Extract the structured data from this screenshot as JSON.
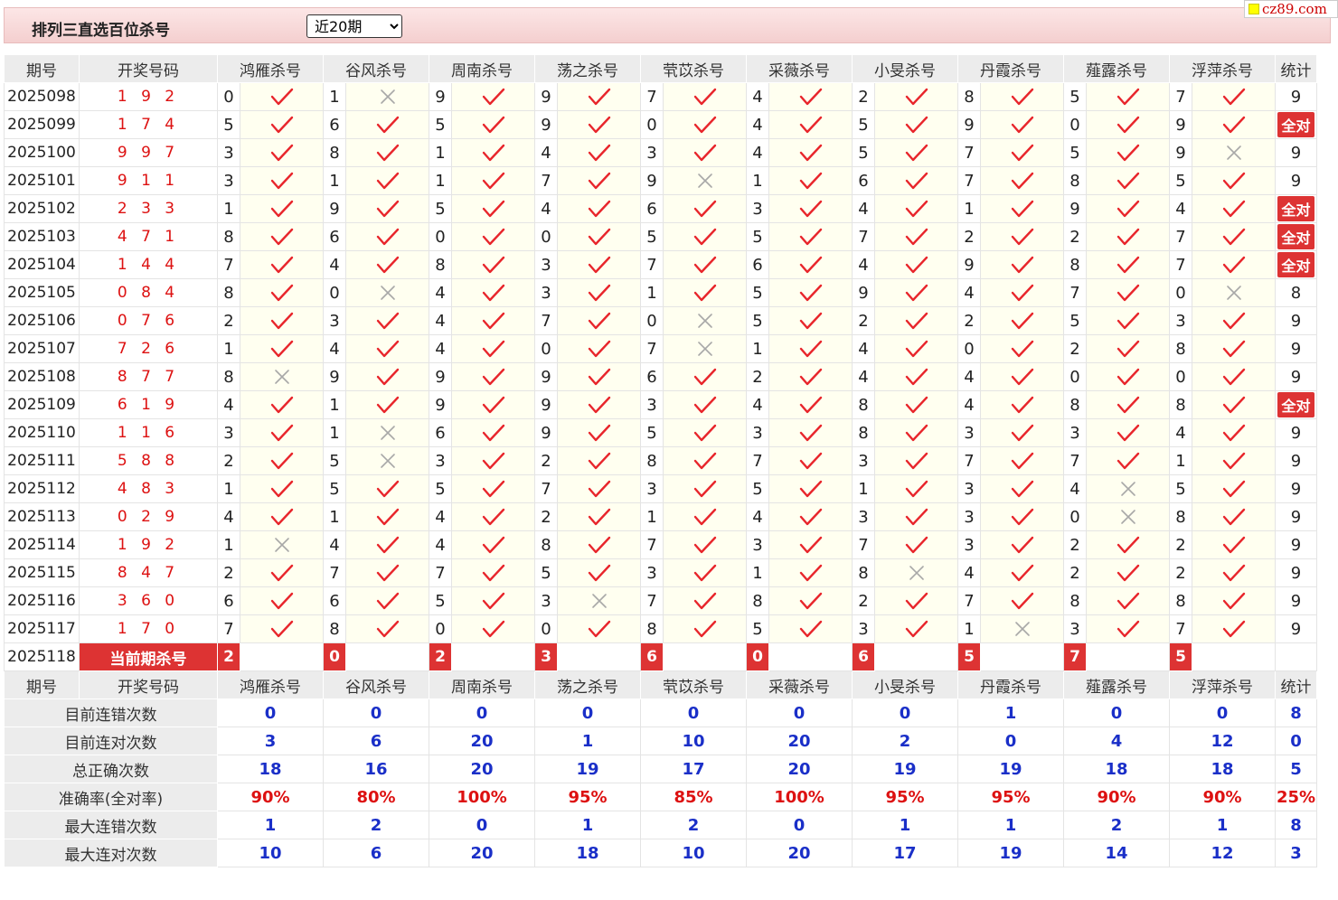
{
  "header": {
    "title": "排列三直选百位杀号",
    "period_selected": "近20期",
    "period_options": [
      "近20期"
    ],
    "site_logo": "cz89.com"
  },
  "columns": {
    "period": "期号",
    "draw": "开奖号码",
    "stat": "统计",
    "experts": [
      "鸿雁杀号",
      "谷风杀号",
      "周南杀号",
      "荡之杀号",
      "茕苡杀号",
      "采薇杀号",
      "小旻杀号",
      "丹霞杀号",
      "薤露杀号",
      "浮萍杀号"
    ]
  },
  "all_correct_label": "全对",
  "rows": [
    {
      "period": "2025098",
      "draw": "1 9 2",
      "kills": [
        0,
        1,
        9,
        9,
        7,
        4,
        2,
        8,
        5,
        7
      ],
      "ok": [
        1,
        0,
        1,
        1,
        1,
        1,
        1,
        1,
        1,
        1
      ],
      "stat": "9"
    },
    {
      "period": "2025099",
      "draw": "1 7 4",
      "kills": [
        5,
        6,
        5,
        9,
        0,
        4,
        5,
        9,
        0,
        9
      ],
      "ok": [
        1,
        1,
        1,
        1,
        1,
        1,
        1,
        1,
        1,
        1
      ],
      "stat": "全对"
    },
    {
      "period": "2025100",
      "draw": "9 9 7",
      "kills": [
        3,
        8,
        1,
        4,
        3,
        4,
        5,
        7,
        5,
        9
      ],
      "ok": [
        1,
        1,
        1,
        1,
        1,
        1,
        1,
        1,
        1,
        0
      ],
      "stat": "9"
    },
    {
      "period": "2025101",
      "draw": "9 1 1",
      "kills": [
        3,
        1,
        1,
        7,
        9,
        1,
        6,
        7,
        8,
        5
      ],
      "ok": [
        1,
        1,
        1,
        1,
        0,
        1,
        1,
        1,
        1,
        1
      ],
      "stat": "9"
    },
    {
      "period": "2025102",
      "draw": "2 3 3",
      "kills": [
        1,
        9,
        5,
        4,
        6,
        3,
        4,
        1,
        9,
        4
      ],
      "ok": [
        1,
        1,
        1,
        1,
        1,
        1,
        1,
        1,
        1,
        1
      ],
      "stat": "全对"
    },
    {
      "period": "2025103",
      "draw": "4 7 1",
      "kills": [
        8,
        6,
        0,
        0,
        5,
        5,
        7,
        2,
        2,
        7
      ],
      "ok": [
        1,
        1,
        1,
        1,
        1,
        1,
        1,
        1,
        1,
        1
      ],
      "stat": "全对"
    },
    {
      "period": "2025104",
      "draw": "1 4 4",
      "kills": [
        7,
        4,
        8,
        3,
        7,
        6,
        4,
        9,
        8,
        7
      ],
      "ok": [
        1,
        1,
        1,
        1,
        1,
        1,
        1,
        1,
        1,
        1
      ],
      "stat": "全对"
    },
    {
      "period": "2025105",
      "draw": "0 8 4",
      "kills": [
        8,
        0,
        4,
        3,
        1,
        5,
        9,
        4,
        7,
        0
      ],
      "ok": [
        1,
        0,
        1,
        1,
        1,
        1,
        1,
        1,
        1,
        0
      ],
      "stat": "8"
    },
    {
      "period": "2025106",
      "draw": "0 7 6",
      "kills": [
        2,
        3,
        4,
        7,
        0,
        5,
        2,
        2,
        5,
        3
      ],
      "ok": [
        1,
        1,
        1,
        1,
        0,
        1,
        1,
        1,
        1,
        1
      ],
      "stat": "9"
    },
    {
      "period": "2025107",
      "draw": "7 2 6",
      "kills": [
        1,
        4,
        4,
        0,
        7,
        1,
        4,
        0,
        2,
        8
      ],
      "ok": [
        1,
        1,
        1,
        1,
        0,
        1,
        1,
        1,
        1,
        1
      ],
      "stat": "9"
    },
    {
      "period": "2025108",
      "draw": "8 7 7",
      "kills": [
        8,
        9,
        9,
        9,
        6,
        2,
        4,
        4,
        0,
        0
      ],
      "ok": [
        0,
        1,
        1,
        1,
        1,
        1,
        1,
        1,
        1,
        1
      ],
      "stat": "9"
    },
    {
      "period": "2025109",
      "draw": "6 1 9",
      "kills": [
        4,
        1,
        9,
        9,
        3,
        4,
        8,
        4,
        8,
        8
      ],
      "ok": [
        1,
        1,
        1,
        1,
        1,
        1,
        1,
        1,
        1,
        1
      ],
      "stat": "全对"
    },
    {
      "period": "2025110",
      "draw": "1 1 6",
      "kills": [
        3,
        1,
        6,
        9,
        5,
        3,
        8,
        3,
        3,
        4
      ],
      "ok": [
        1,
        0,
        1,
        1,
        1,
        1,
        1,
        1,
        1,
        1
      ],
      "stat": "9"
    },
    {
      "period": "2025111",
      "draw": "5 8 8",
      "kills": [
        2,
        5,
        3,
        2,
        8,
        7,
        3,
        7,
        7,
        1
      ],
      "ok": [
        1,
        0,
        1,
        1,
        1,
        1,
        1,
        1,
        1,
        1
      ],
      "stat": "9"
    },
    {
      "period": "2025112",
      "draw": "4 8 3",
      "kills": [
        1,
        5,
        5,
        7,
        3,
        5,
        1,
        3,
        4,
        5
      ],
      "ok": [
        1,
        1,
        1,
        1,
        1,
        1,
        1,
        1,
        0,
        1
      ],
      "stat": "9"
    },
    {
      "period": "2025113",
      "draw": "0 2 9",
      "kills": [
        4,
        1,
        4,
        2,
        1,
        4,
        3,
        3,
        0,
        8
      ],
      "ok": [
        1,
        1,
        1,
        1,
        1,
        1,
        1,
        1,
        0,
        1
      ],
      "stat": "9"
    },
    {
      "period": "2025114",
      "draw": "1 9 2",
      "kills": [
        1,
        4,
        4,
        8,
        7,
        3,
        7,
        3,
        2,
        2
      ],
      "ok": [
        0,
        1,
        1,
        1,
        1,
        1,
        1,
        1,
        1,
        1
      ],
      "stat": "9"
    },
    {
      "period": "2025115",
      "draw": "8 4 7",
      "kills": [
        2,
        7,
        7,
        5,
        3,
        1,
        8,
        4,
        2,
        2
      ],
      "ok": [
        1,
        1,
        1,
        1,
        1,
        1,
        0,
        1,
        1,
        1
      ],
      "stat": "9"
    },
    {
      "period": "2025116",
      "draw": "3 6 0",
      "kills": [
        6,
        6,
        5,
        3,
        7,
        8,
        2,
        7,
        8,
        8
      ],
      "ok": [
        1,
        1,
        1,
        0,
        1,
        1,
        1,
        1,
        1,
        1
      ],
      "stat": "9"
    },
    {
      "period": "2025117",
      "draw": "1 7 0",
      "kills": [
        7,
        8,
        0,
        0,
        8,
        5,
        3,
        1,
        3,
        7
      ],
      "ok": [
        1,
        1,
        1,
        1,
        1,
        1,
        1,
        0,
        1,
        1
      ],
      "stat": "9"
    }
  ],
  "current": {
    "period": "2025118",
    "label": "当前期杀号",
    "kills": [
      2,
      0,
      2,
      3,
      6,
      0,
      6,
      5,
      7,
      5
    ]
  },
  "stats": [
    {
      "label": "目前连错次数",
      "values": [
        "0",
        "0",
        "0",
        "0",
        "0",
        "0",
        "0",
        "1",
        "0",
        "0"
      ],
      "stat": "8",
      "pct": false
    },
    {
      "label": "目前连对次数",
      "values": [
        "3",
        "6",
        "20",
        "1",
        "10",
        "20",
        "2",
        "0",
        "4",
        "12"
      ],
      "stat": "0",
      "pct": false
    },
    {
      "label": "总正确次数",
      "values": [
        "18",
        "16",
        "20",
        "19",
        "17",
        "20",
        "19",
        "19",
        "18",
        "18"
      ],
      "stat": "5",
      "pct": false
    },
    {
      "label": "准确率(全对率)",
      "values": [
        "90%",
        "80%",
        "100%",
        "95%",
        "85%",
        "100%",
        "95%",
        "95%",
        "90%",
        "90%"
      ],
      "stat": "25%",
      "pct": true
    },
    {
      "label": "最大连错次数",
      "values": [
        "1",
        "2",
        "0",
        "1",
        "2",
        "0",
        "1",
        "1",
        "2",
        "1"
      ],
      "stat": "8",
      "pct": false
    },
    {
      "label": "最大连对次数",
      "values": [
        "10",
        "6",
        "20",
        "18",
        "10",
        "20",
        "17",
        "19",
        "14",
        "12"
      ],
      "stat": "3",
      "pct": false
    }
  ],
  "colors": {
    "check": "#e8252b",
    "cross": "#a8a8a8",
    "badge": "#d33333",
    "stat_blue": "#1a2fc8",
    "pct_red": "#d11111"
  }
}
